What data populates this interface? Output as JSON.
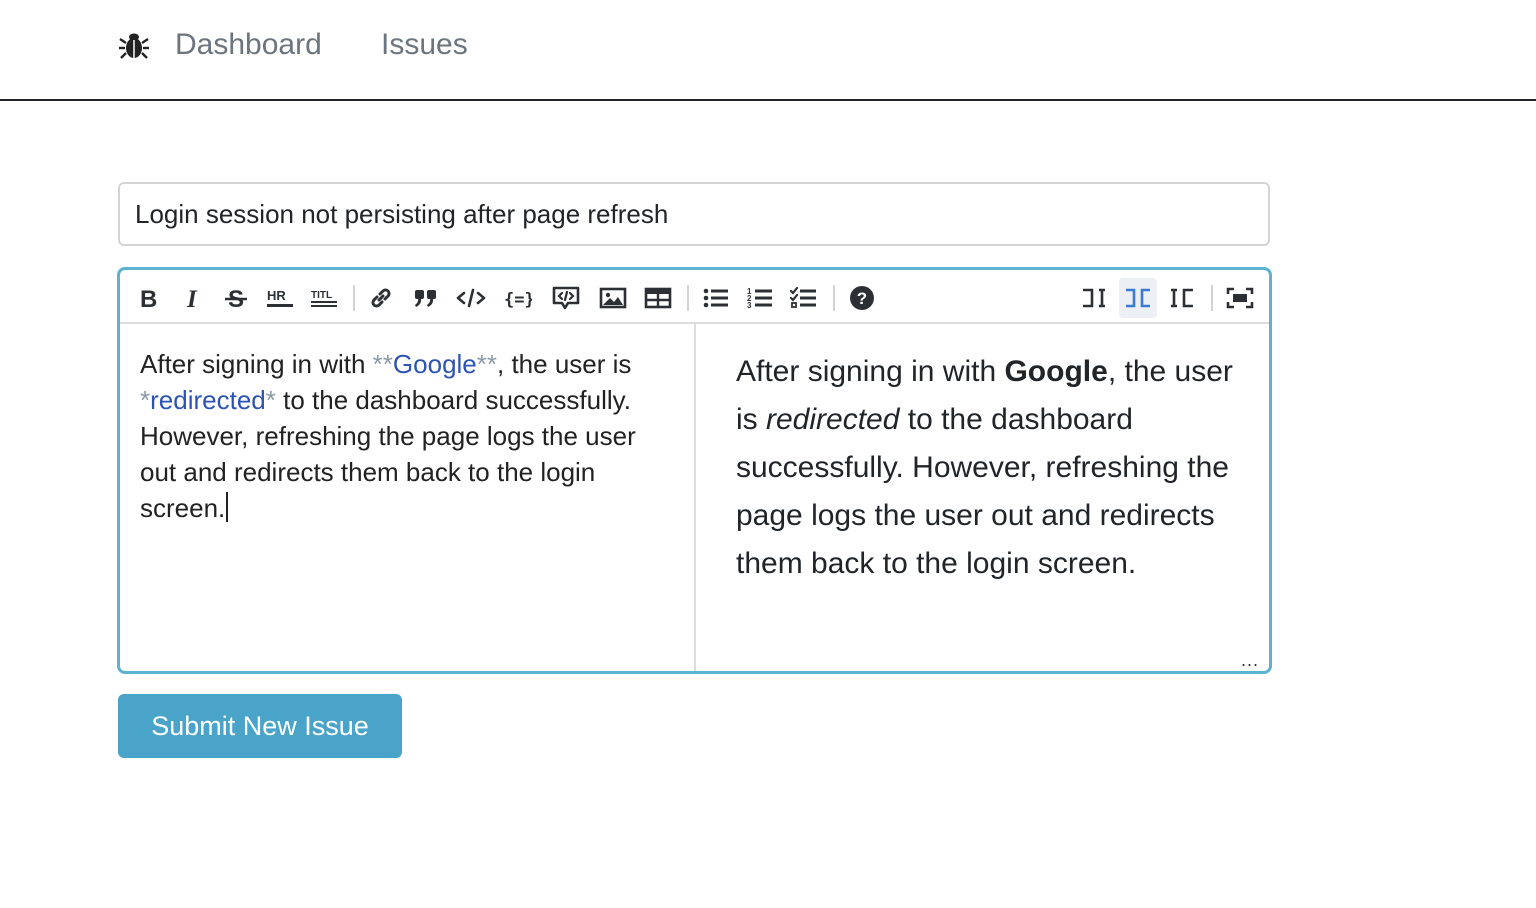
{
  "nav": {
    "brand_icon": "bug-icon",
    "links": [
      {
        "label": "Dashboard"
      },
      {
        "label": "Issues"
      }
    ]
  },
  "form": {
    "title_value": "Login session not persisting after page refresh",
    "submit_label": "Submit New Issue"
  },
  "editor": {
    "toolbar_icons": [
      "bold-icon",
      "italic-icon",
      "strikethrough-icon",
      "horizontal-rule-icon",
      "title-icon",
      "link-icon",
      "quote-icon",
      "inline-code-icon",
      "code-block-icon",
      "comment-code-icon",
      "image-icon",
      "table-icon",
      "bullet-list-icon",
      "numbered-list-icon",
      "checklist-icon",
      "help-icon",
      "edit-mode-icon",
      "split-mode-icon",
      "preview-mode-icon",
      "fullscreen-icon"
    ],
    "active_mode": "split-mode-icon",
    "source": {
      "t1": "After signing in with ",
      "m1": "**",
      "w1": "Google",
      "m2": "**",
      "t2": ", the user is ",
      "m3": "*",
      "w2": "redirected",
      "m4": "*",
      "t3": " to the dashboard successfully. However, refreshing the page logs the user out and redirects them back to the login screen."
    },
    "preview": {
      "p1": "After signing in with ",
      "bold": "Google",
      "p2": ", the user is ",
      "italic": "redirected",
      "p3": " to the dashboard successfully. However, refreshing the page logs the user out and redirects them back to the login screen."
    },
    "resize_handle": "..."
  },
  "colors": {
    "editor_border": "#5bb3cf",
    "button_bg": "#4aa3c8",
    "markdown_syntax": "#8a9aa5",
    "markdown_word": "#2d54b3",
    "nav_link": "#6c757d"
  }
}
